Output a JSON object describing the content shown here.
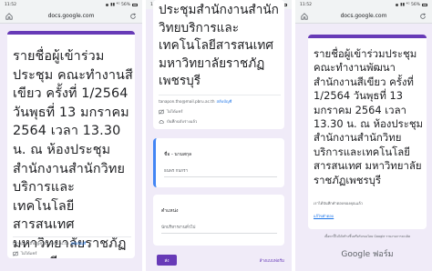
{
  "phone1": {
    "status": {
      "time": "11:52",
      "icons": "▮▮ ⁴ᴳ 56%"
    },
    "url": "docs.google.com",
    "title": "รายชื่อผู้เข้าร่วมประชุม คณะทำงานสีเขียว ครั้งที่ 1/2564 วันพุธที่ 13 มกราคม 2564 เวลา 13.30 น. ณ ห้องประชุมสำนักงานสำนักวิทยบริการและเทคโนโลยีสารสนเทศ มหาวิทยาลัยราชภัฏเพชรบุรี",
    "account_email": "tanapon.tho@mail.pbru.ac.th",
    "switch_account": "สลับบัญชี",
    "not_shared": "ไม่ได้แชร์"
  },
  "phone2": {
    "status": {
      "time": "11:52",
      "icons": "▮▮ ⁴ᴳ 56%"
    },
    "title_partial": "ประชุมสำนักงานสำนักวิทยบริการและเทคโนโลยีสารสนเทศ มหาวิทยาลัยราชภัฏเพชรบุรี",
    "account_email": "tanapon.tho@mail.pbru.ac.th",
    "switch_account": "สลับบัญชี",
    "not_shared": "ไม่ได้แชร์",
    "autosave": "บันทึกฉบับร่างแล้ว",
    "field1_label": "ชื่อ - นามสกุล",
    "field1_value": "ธนพร กนกรา",
    "field2_label": "ตำแหน่ง",
    "field2_value": "นักบริหารงานทั่วไป",
    "submit_label": "ส่ง",
    "clear_label": "ล้างแบบฟอร์ม"
  },
  "phone3": {
    "status": {
      "time": "11:52",
      "icons": "▮▮ ⁴ᴳ 56%"
    },
    "url": "docs.google.com",
    "title": "รายชื่อผู้เข้าร่วมประชุม คณะทำงานพัฒนาสำนักงานสีเขียว ครั้งที่ 1/2564 วันพุธที่ 13 มกราคม 2564 เวลา 13.30 น. ณ ห้องประชุมสำนักงานสำนักวิทยบริการและเทคโนโลยีสารสนเทศ มหาวิทยาลัยราชภัฏเพชรบุรี",
    "response_recorded": "เราได้บันทึกคำตอบของคุณแล้ว",
    "edit_response": "แก้ไขคำตอบ",
    "footer_notice": "เนื้อหานี้ไม่ได้สร้างขึ้นหรือรับรองโดย Google รายงานการละเมิด",
    "google_brand": "Google ฟอร์ม"
  },
  "colors": {
    "accent": "#673ab7",
    "background": "#f0ebf8",
    "link": "#1a73e8"
  }
}
